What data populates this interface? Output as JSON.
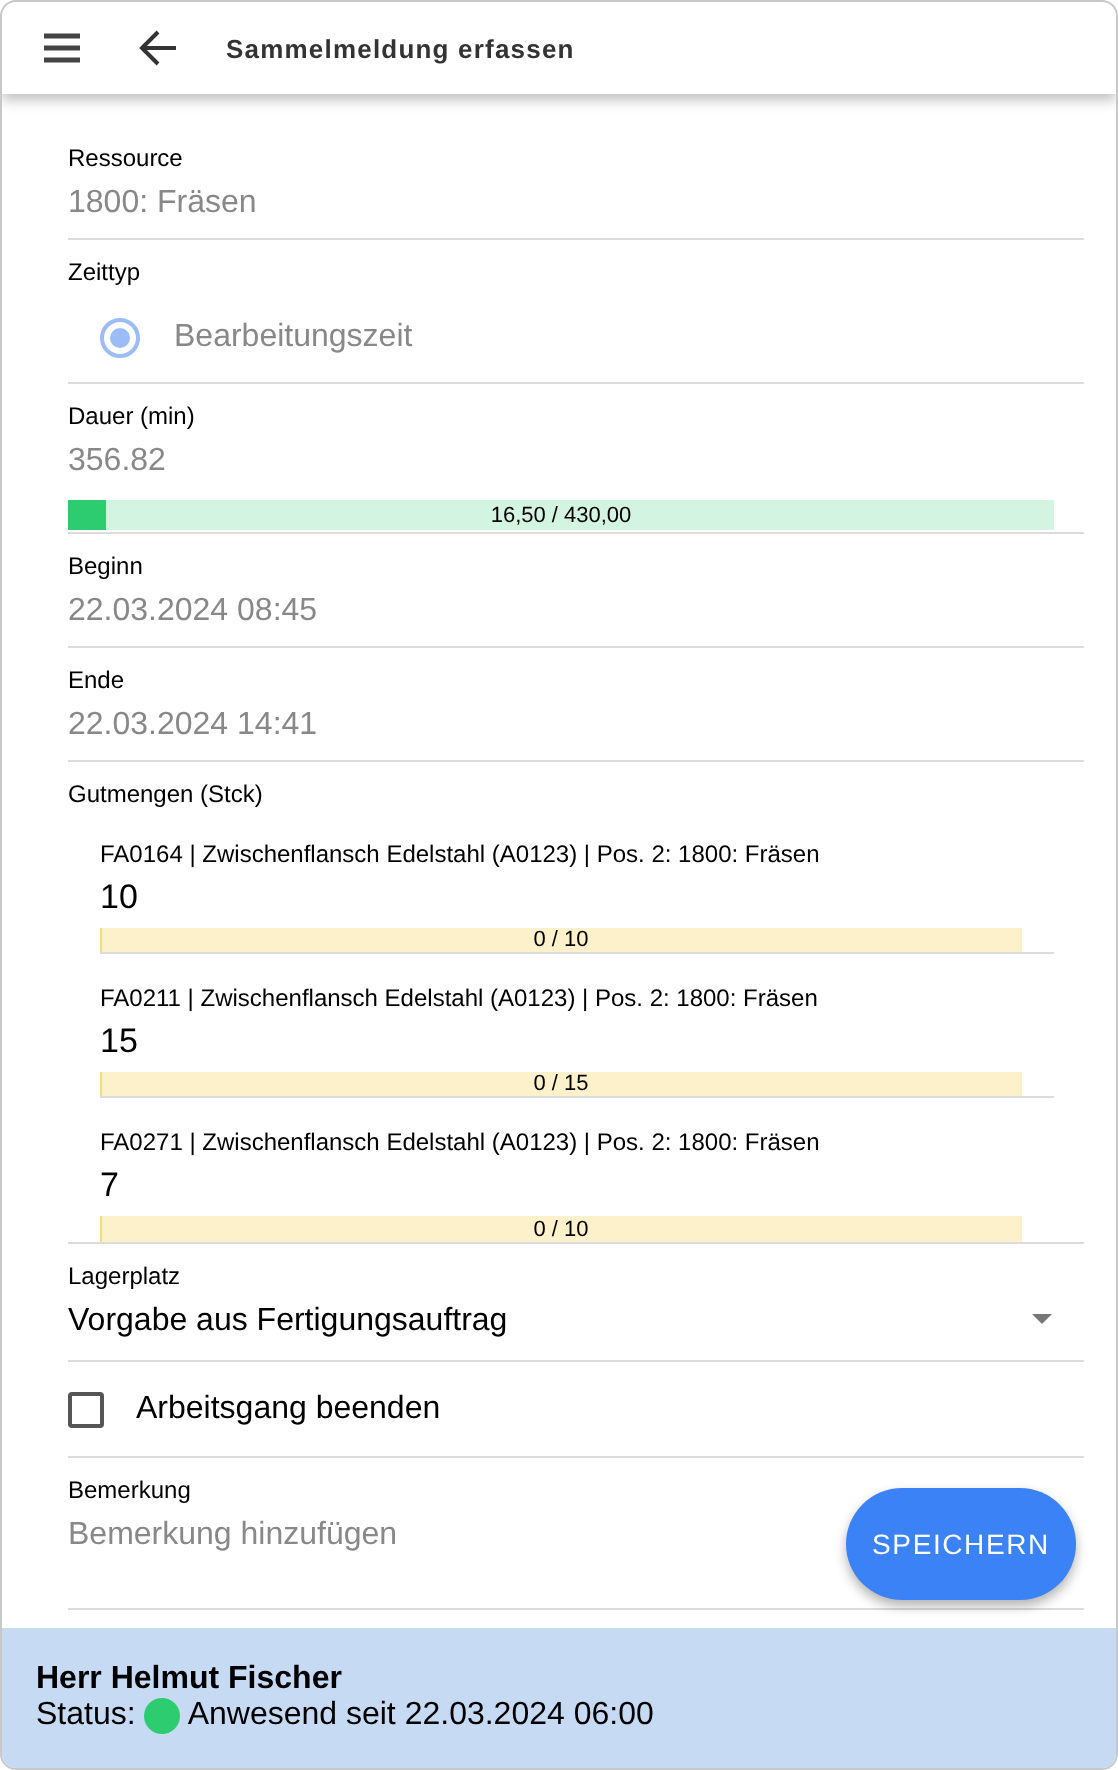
{
  "header": {
    "title": "Sammelmeldung erfassen"
  },
  "fields": [
    {
      "kind": "text",
      "label": "Ressource",
      "value": "1800: Fräsen"
    },
    {
      "kind": "radio",
      "label": "Zeittyp",
      "options": [
        {
          "label": "Bearbeitungszeit",
          "selected": true
        }
      ]
    },
    {
      "kind": "progress",
      "label": "Dauer (min)",
      "value": "356.82",
      "level": 0.038,
      "reading": "16,50 / 430,00"
    },
    {
      "kind": "text",
      "label": "Beginn",
      "value": "22.03.2024 08:45"
    },
    {
      "kind": "text",
      "label": "Ende",
      "value": "22.03.2024 14:41"
    },
    {
      "kind": "quantities",
      "label": "Gutmengen (Stck)",
      "items": [
        {
          "title": "FA0164 | Zwischenflansch Edelstahl (A0123) | Pos. 2: 1800: Fräsen",
          "value": "10",
          "level": 0,
          "reading": "0 / 10"
        },
        {
          "title": "FA0211 | Zwischenflansch Edelstahl (A0123) | Pos. 2: 1800: Fräsen",
          "value": "15",
          "level": 0,
          "reading": "0 / 15"
        },
        {
          "title": "FA0271 | Zwischenflansch Edelstahl (A0123) | Pos. 2: 1800: Fräsen",
          "value": "7",
          "level": 0,
          "reading": "0 / 10"
        }
      ]
    },
    {
      "kind": "select",
      "label": "Lagerplatz",
      "value": "Vorgabe aus Fertigungsauftrag"
    },
    {
      "kind": "checkbox",
      "label": "Arbeitsgang beenden",
      "checked": false
    },
    {
      "kind": "textarea",
      "label": "Bemerkung",
      "placeholder": "Bemerkung hinzufügen"
    }
  ],
  "save_button": "SPEICHERN",
  "user": {
    "name": "Herr Helmut Fischer",
    "status_label": "Status:",
    "status": "Anwesend seit 22.03.2024 06:00",
    "present": true
  }
}
